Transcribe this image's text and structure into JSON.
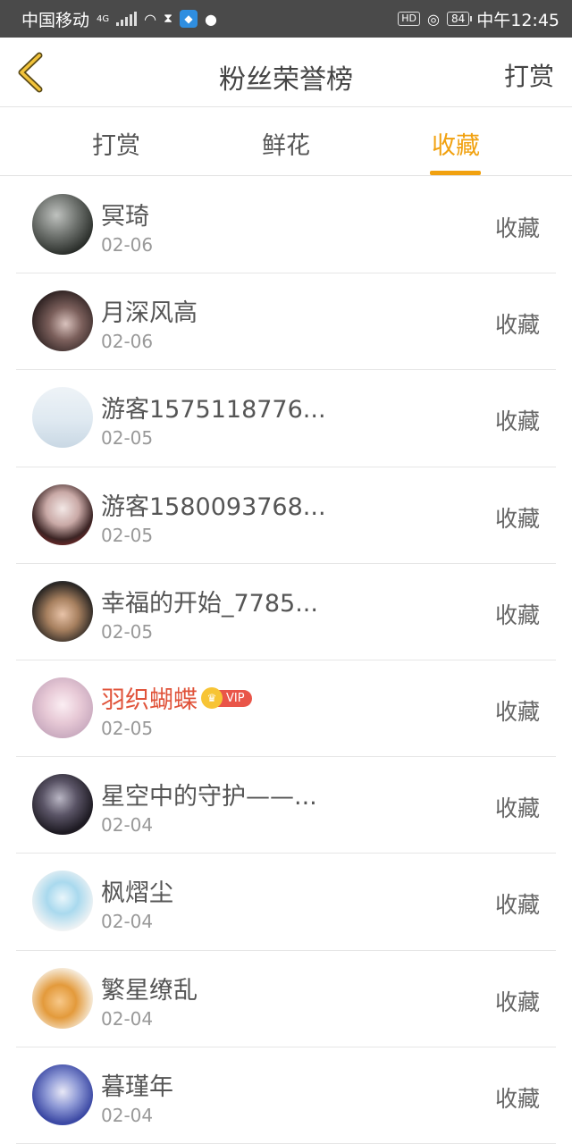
{
  "status_bar": {
    "carrier": "中国移动",
    "net": "4G",
    "hd": "HD",
    "battery": "84",
    "time": "中午12:45"
  },
  "header": {
    "title": "粉丝荣誉榜",
    "action": "打赏"
  },
  "tabs": [
    {
      "label": "打赏"
    },
    {
      "label": "鲜花"
    },
    {
      "label": "收藏",
      "active": true
    }
  ],
  "accent_color": "#f1a10f",
  "vip_name_color": "#e0533a",
  "rows": [
    {
      "name": "冥琦",
      "date": "02-06",
      "action": "收藏"
    },
    {
      "name": "月深风高",
      "date": "02-06",
      "action": "收藏"
    },
    {
      "name": "游客1575118776...",
      "date": "02-05",
      "action": "收藏"
    },
    {
      "name": "游客1580093768...",
      "date": "02-05",
      "action": "收藏"
    },
    {
      "name": "幸福的开始_7785...",
      "date": "02-05",
      "action": "收藏"
    },
    {
      "name": "羽织蝴蝶",
      "date": "02-05",
      "action": "收藏",
      "vip": "VIP"
    },
    {
      "name": "星空中的守护——...",
      "date": "02-04",
      "action": "收藏"
    },
    {
      "name": "枫熠尘",
      "date": "02-04",
      "action": "收藏"
    },
    {
      "name": "繁星缭乱",
      "date": "02-04",
      "action": "收藏"
    },
    {
      "name": "暮瑾年",
      "date": "02-04",
      "action": "收藏"
    }
  ]
}
